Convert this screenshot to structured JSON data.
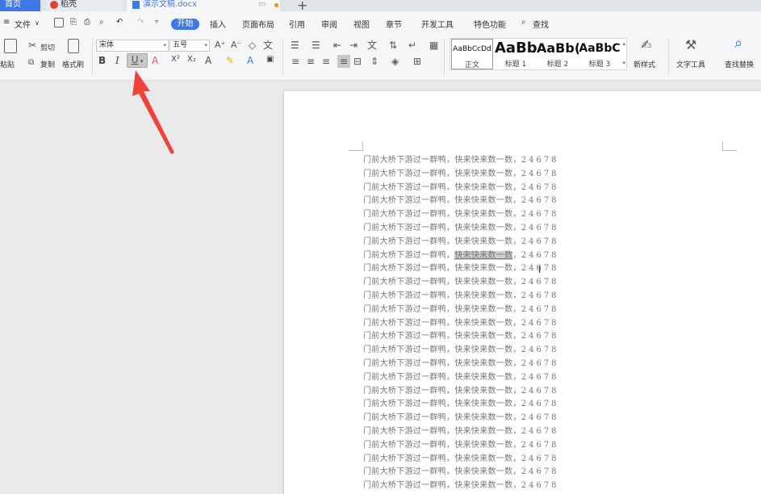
{
  "tabs": {
    "home": "首页",
    "daoke": "稻壳",
    "doc": "演示文稿.docx"
  },
  "menu": {
    "file": "文件",
    "items": [
      "开始",
      "插入",
      "页面布局",
      "引用",
      "审阅",
      "视图",
      "章节",
      "开发工具",
      "特色功能"
    ],
    "search": "查找"
  },
  "ribbon": {
    "paste": "粘贴",
    "cut": "剪切",
    "copy": "复制",
    "format_painter": "格式刷",
    "font_name": "宋体",
    "font_size": "五号",
    "bold": "B",
    "italic": "I",
    "underline": "U",
    "styles": [
      {
        "preview": "AaBbCcDd",
        "name": "正文"
      },
      {
        "preview": "AaBb",
        "name": "标题 1"
      },
      {
        "preview": "AaBb(",
        "name": "标题 2"
      },
      {
        "preview": "AaBbC",
        "name": "标题 3"
      }
    ],
    "new_style": "新样式",
    "text_tools": "文字工具",
    "find_replace": "查找替换"
  },
  "document": {
    "line_prefix": "门前大桥下游过一群鸭，",
    "line_mid": "快来快来数一数",
    "line_sep": "，",
    "line_suffix": "24678",
    "line_count": 25,
    "highlighted_line": 8
  },
  "colors": {
    "accent": "#3e78e6",
    "annotation_arrow": "#f0413a"
  }
}
